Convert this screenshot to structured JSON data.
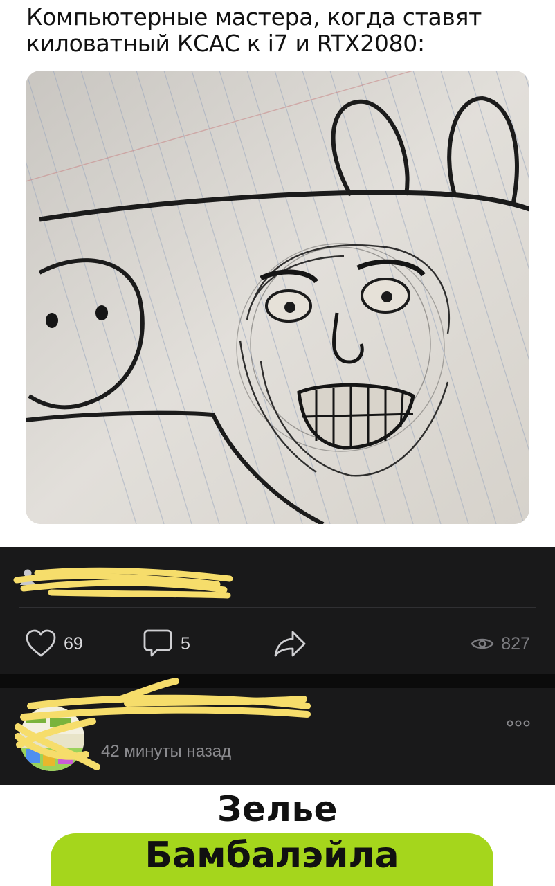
{
  "meme": {
    "caption_line1": "Компьютерные мастера, когда ставят",
    "caption_line2": "киловатный КСАС к i7 и RTX2080:",
    "image_icon": "pig-drawing-with-scary-face"
  },
  "post": {
    "author_icon": "user-icon",
    "likes": "69",
    "comments": "5",
    "views": "827",
    "colors": {
      "background": "#19191a",
      "scribble": "#f6dd6b",
      "icon": "#cfcfd2"
    }
  },
  "comment": {
    "timestamp": "42 минуты назад",
    "more_icon": "more-horizontal-icon"
  },
  "footer": {
    "title_line1": "Зелье",
    "title_line2": "Бамбалэйла",
    "accent": "#a5d61c"
  }
}
